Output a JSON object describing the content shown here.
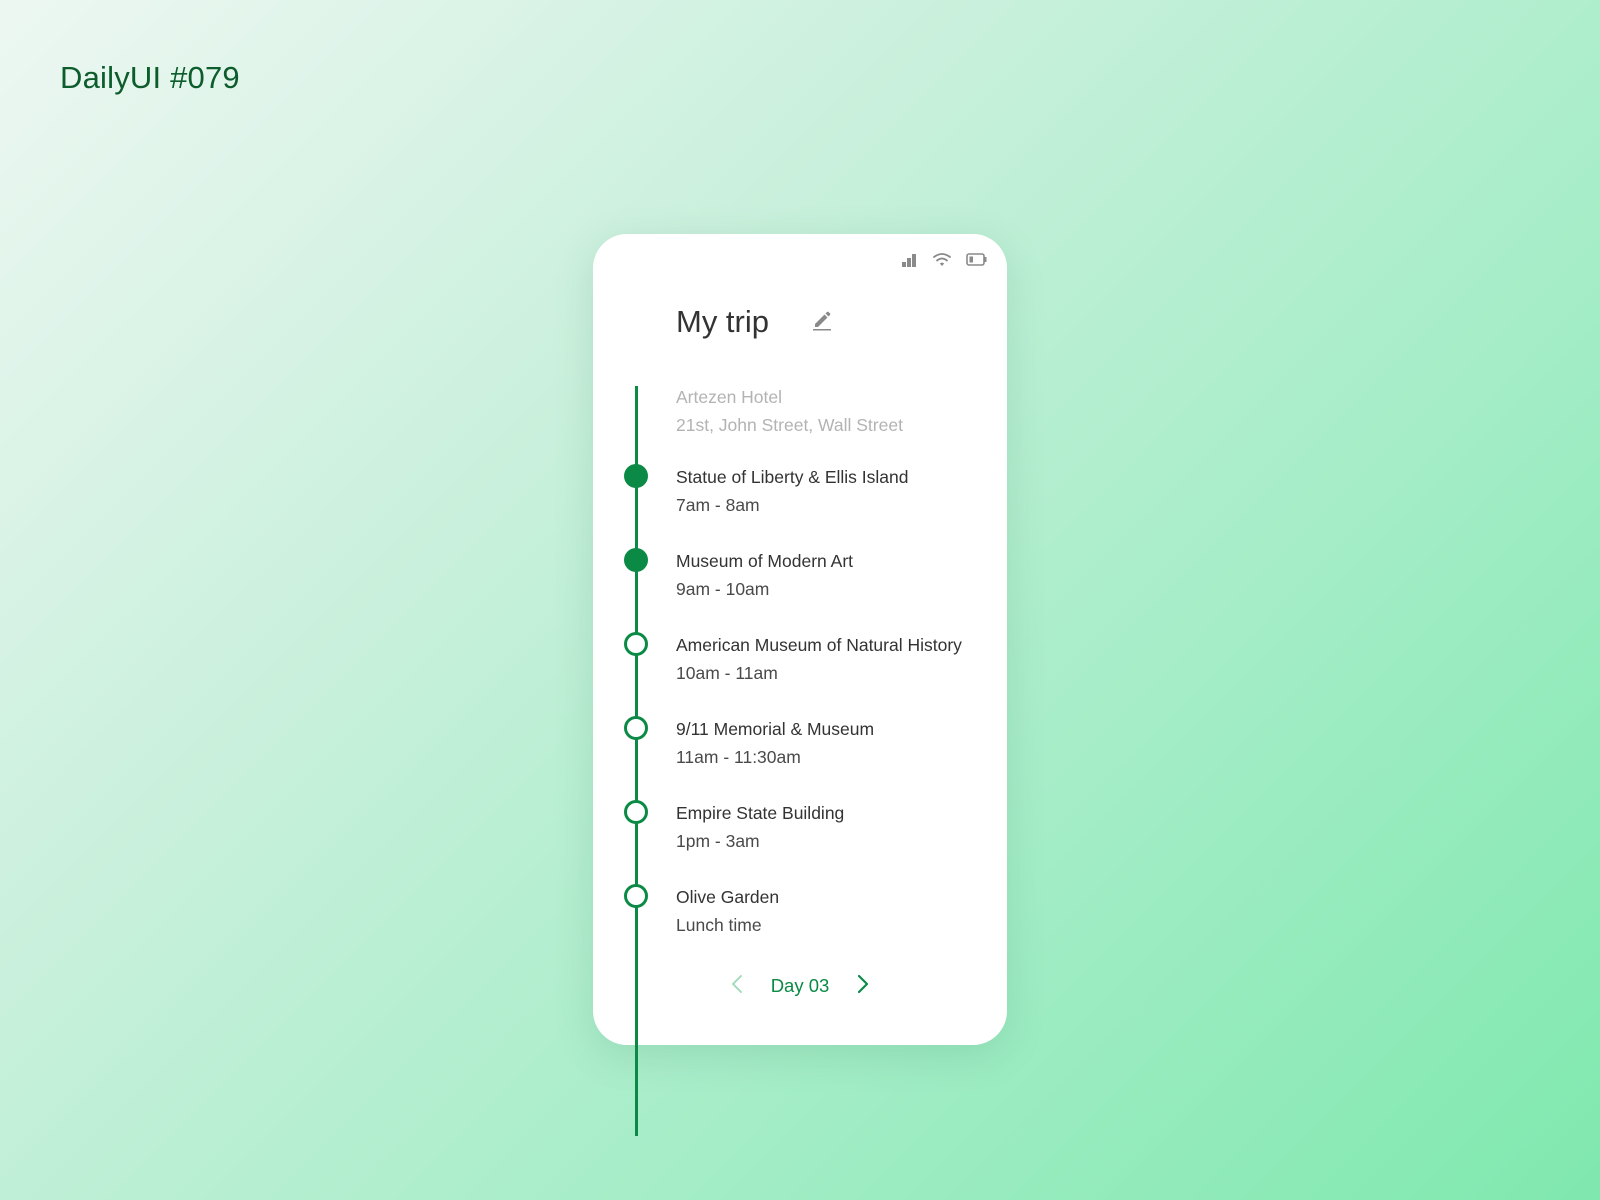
{
  "caption": "DailyUI #079",
  "colors": {
    "accent": "#0b8a46",
    "caption": "#0c5c2c",
    "text_primary": "#333333",
    "text_muted": "#b3b3b3",
    "arrow_disabled": "#a8dcc0"
  },
  "status_bar": {
    "icons": [
      "signal-icon",
      "wifi-icon",
      "battery-icon"
    ]
  },
  "header": {
    "title": "My trip",
    "edit_icon": "pencil-icon"
  },
  "itinerary": {
    "origin": {
      "name": "Artezen Hotel",
      "address": "21st, John Street, Wall Street"
    },
    "stops": [
      {
        "name": "Statue of Liberty & Ellis Island",
        "time": "7am - 8am",
        "status": "completed"
      },
      {
        "name": "Museum of Modern Art",
        "time": "9am - 10am",
        "status": "completed"
      },
      {
        "name": "American Museum of Natural History",
        "time": "10am - 11am",
        "status": "upcoming"
      },
      {
        "name": "9/11 Memorial & Museum",
        "time": "11am - 11:30am",
        "status": "upcoming"
      },
      {
        "name": "Empire State Building",
        "time": "1pm - 3am",
        "status": "upcoming"
      },
      {
        "name": "Olive Garden",
        "time": "Lunch time",
        "status": "upcoming"
      }
    ]
  },
  "day_nav": {
    "label": "Day 03",
    "prev_icon": "chevron-left-icon",
    "next_icon": "chevron-right-icon"
  }
}
